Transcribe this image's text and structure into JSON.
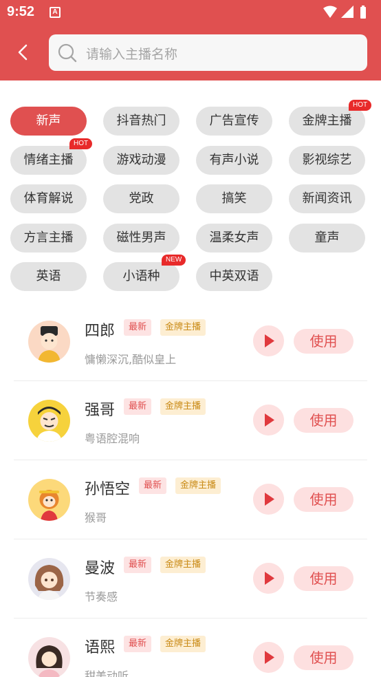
{
  "status_bar": {
    "time": "9:52",
    "notification_glyph": "A"
  },
  "search": {
    "placeholder": "请输入主播名称"
  },
  "categories": [
    {
      "label": "新声",
      "active": true
    },
    {
      "label": "抖音热门"
    },
    {
      "label": "广告宣传"
    },
    {
      "label": "金牌主播",
      "badge": "HOT"
    },
    {
      "label": "情绪主播",
      "badge": "HOT"
    },
    {
      "label": "游戏动漫"
    },
    {
      "label": "有声小说"
    },
    {
      "label": "影视综艺"
    },
    {
      "label": "体育解说"
    },
    {
      "label": "党政"
    },
    {
      "label": "搞笑"
    },
    {
      "label": "新闻资讯"
    },
    {
      "label": "方言主播"
    },
    {
      "label": "磁性男声"
    },
    {
      "label": "温柔女声"
    },
    {
      "label": "童声"
    },
    {
      "label": "英语"
    },
    {
      "label": "小语种",
      "badge": "NEW"
    },
    {
      "label": "中英双语"
    }
  ],
  "voices": [
    {
      "name": "四郎",
      "tag_new": "最新",
      "tag_gold": "金牌主播",
      "desc": "慵懒深沉,酷似皇上",
      "use_label": "使用"
    },
    {
      "name": "强哥",
      "tag_new": "最新",
      "tag_gold": "金牌主播",
      "desc": "粤语腔混响",
      "use_label": "使用"
    },
    {
      "name": "孙悟空",
      "tag_new": "最新",
      "tag_gold": "金牌主播",
      "desc": "猴哥",
      "use_label": "使用"
    },
    {
      "name": "曼波",
      "tag_new": "最新",
      "tag_gold": "金牌主播",
      "desc": "节奏感",
      "use_label": "使用"
    },
    {
      "name": "语熙",
      "tag_new": "最新",
      "tag_gold": "金牌主播",
      "desc": "甜美动听",
      "use_label": "使用"
    }
  ],
  "colors": {
    "brand": "#e05050",
    "badge": "#e82a2a",
    "chip": "#e3e3e3",
    "gold_tag": "#c98a15"
  }
}
